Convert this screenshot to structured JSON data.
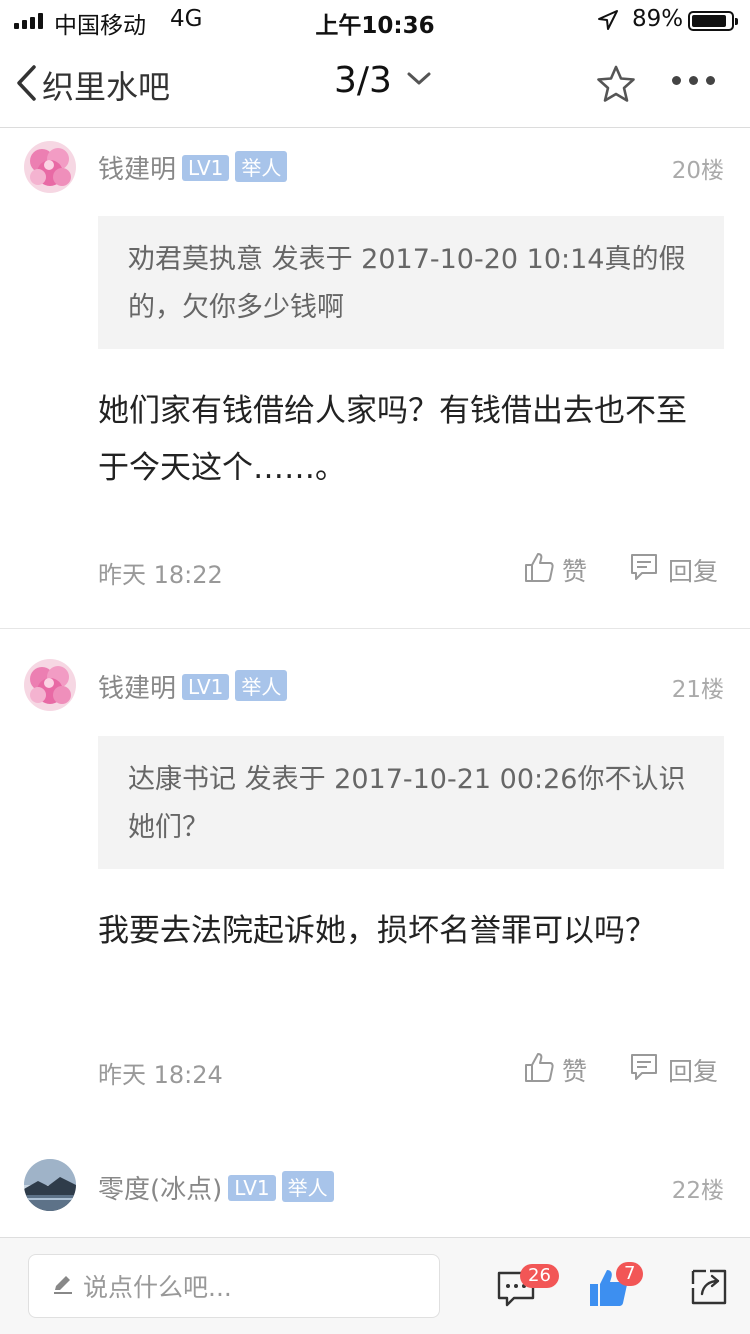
{
  "status_bar": {
    "carrier": "中国移动",
    "network": "4G",
    "time": "上午10:36",
    "battery": "89%",
    "battery_level": 0.89
  },
  "nav": {
    "back_label": "织里水吧",
    "page_indicator": "3/3",
    "back_icon": "chevron-left-icon",
    "dropdown_icon": "chevron-down-icon",
    "favorite_icon": "star-icon",
    "more_icon": "more-dots-icon"
  },
  "posts": [
    {
      "user": "钱建明",
      "level": "LV1",
      "report": "举人",
      "floor": "20楼",
      "quote": "劝君莫执意 发表于 2017-10-20 10:14真的假的，欠你多少钱啊",
      "content": "她们家有钱借给人家吗？有钱借出去也不至于今天这个……。",
      "time": "昨天 18:22",
      "like_label": "赞",
      "reply_label": "回复"
    },
    {
      "user": "钱建明",
      "level": "LV1",
      "report": "举人",
      "floor": "21楼",
      "quote": "达康书记 发表于 2017-10-21 00:26你不认识她们？",
      "content": "我要去法院起诉她，损坏名誉罪可以吗？",
      "time": "昨天 18:24",
      "like_label": "赞",
      "reply_label": "回复"
    },
    {
      "user": "零度(冰点)",
      "level": "LV1",
      "report": "举人",
      "floor": "22楼"
    }
  ],
  "bottom_bar": {
    "placeholder": "说点什么吧...",
    "comment_count": "26",
    "like_count": "7",
    "accent_color": "#3d8ff0",
    "badge_color": "#f25656"
  }
}
